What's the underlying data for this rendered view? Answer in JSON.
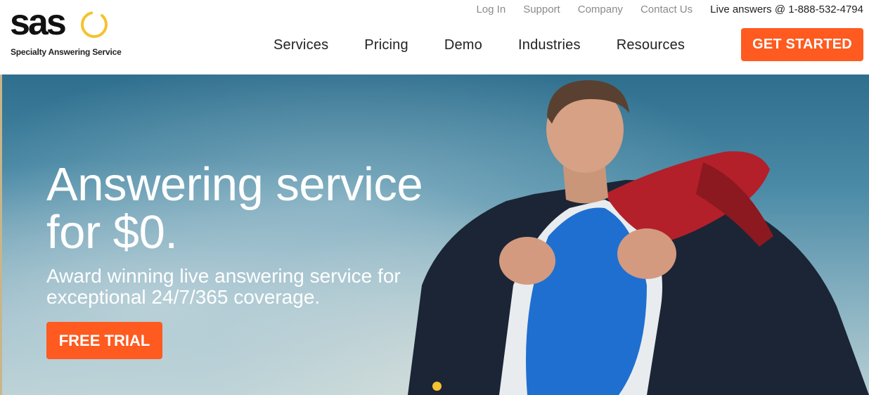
{
  "brand": {
    "wordmark": "sas",
    "tagline": "Specialty Answering Service",
    "accent_color": "#f5c230",
    "cta_color": "#ff5a1f"
  },
  "utility_nav": {
    "links": [
      "Log In",
      "Support",
      "Company",
      "Contact Us"
    ],
    "phone": "Live answers @ 1-888-532-4794"
  },
  "main_nav": {
    "items": [
      "Services",
      "Pricing",
      "Demo",
      "Industries",
      "Resources"
    ],
    "cta": "GET STARTED"
  },
  "hero": {
    "headline_line1": "Answering service",
    "headline_line2": "for $0.",
    "subtext_line1": "Award winning live answering service for",
    "subtext_line2": "exceptional 24/7/365 coverage.",
    "button": "FREE TRIAL",
    "image_subject": "businessman-opening-shirt-superhero"
  }
}
